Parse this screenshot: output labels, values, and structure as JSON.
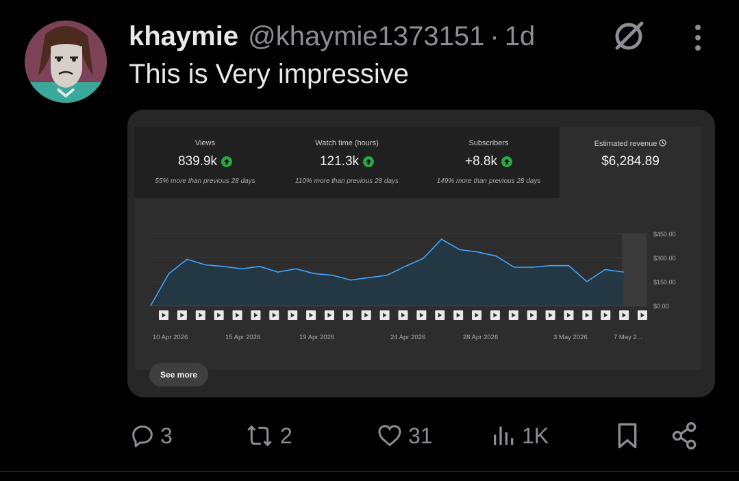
{
  "post": {
    "author_name": "khaymie",
    "handle": "@khaymie1373151",
    "separator": "·",
    "time": "1d",
    "text": "This is Very impressive"
  },
  "analytics": {
    "metrics": [
      {
        "label": "Views",
        "value": "839.9k",
        "sub": "55% more than previous 28 days"
      },
      {
        "label": "Watch time (hours)",
        "value": "121.3k",
        "sub": "110% more than previous 28 days"
      },
      {
        "label": "Subscribers",
        "value": "+8.8k",
        "sub": "149% more than previous 28 days"
      },
      {
        "label": "Estimated revenue",
        "value": "$6,284.89",
        "sub": ""
      }
    ],
    "see_more": "See more"
  },
  "chart_data": {
    "type": "area",
    "x": [
      "10 Apr 2026",
      "11 Apr 2026",
      "12 Apr 2026",
      "13 Apr 2026",
      "14 Apr 2026",
      "15 Apr 2026",
      "16 Apr 2026",
      "17 Apr 2026",
      "18 Apr 2026",
      "19 Apr 2026",
      "20 Apr 2026",
      "21 Apr 2026",
      "22 Apr 2026",
      "23 Apr 2026",
      "24 Apr 2026",
      "25 Apr 2026",
      "26 Apr 2026",
      "27 Apr 2026",
      "28 Apr 2026",
      "29 Apr 2026",
      "30 Apr 2026",
      "1 May 2026",
      "2 May 2026",
      "3 May 2026",
      "4 May 2026",
      "5 May 2026",
      "6 May 2026",
      "7 May 2026"
    ],
    "series": [
      {
        "values": [
          0,
          200,
          290,
          255,
          245,
          230,
          245,
          210,
          230,
          200,
          190,
          160,
          175,
          190,
          245,
          295,
          415,
          350,
          335,
          310,
          240,
          240,
          250,
          250,
          150,
          225,
          210
        ]
      }
    ],
    "x_tick_labels": [
      "10 Apr 2026",
      "15 Apr 2026",
      "19 Apr 2026",
      "24 Apr 2026",
      "28 Apr 2026",
      "3 May 2026",
      "7 May 2..."
    ],
    "y_tick_labels": [
      "$450.00",
      "$300.00",
      "$150.00",
      "$0.00"
    ],
    "ylim": [
      0,
      450
    ],
    "title": "",
    "xlabel": "",
    "ylabel": "",
    "grid": true,
    "colors": {
      "line": "#3ea6ff",
      "fill": "#243844"
    }
  },
  "actions": {
    "replies": "3",
    "reposts": "2",
    "likes": "31",
    "views": "1K"
  },
  "icons": [
    "avatar",
    "grok-icon",
    "more-icon",
    "trend-up-icon",
    "clock-icon",
    "video-marker-icon",
    "reply-icon",
    "repost-icon",
    "like-icon",
    "views-icon",
    "bookmark-icon",
    "share-icon"
  ]
}
